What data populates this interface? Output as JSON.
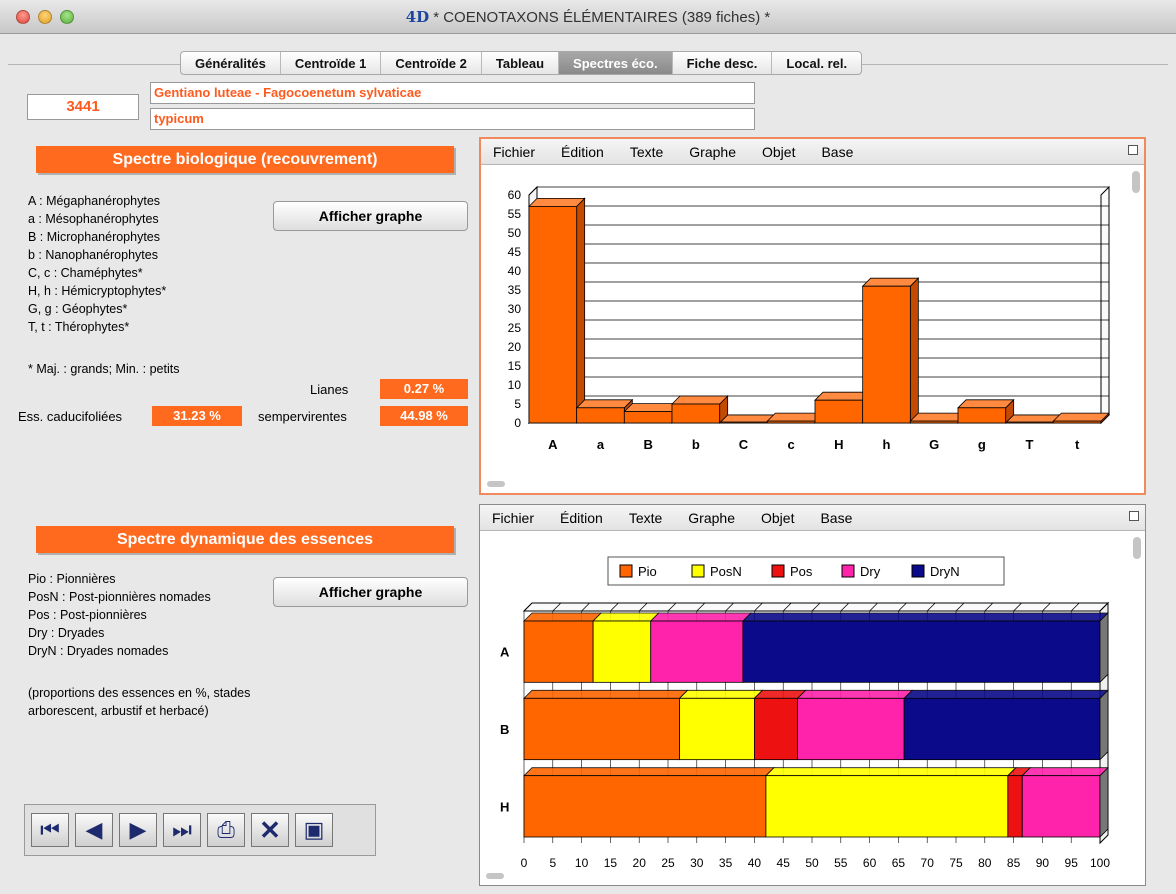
{
  "window": {
    "logo": "4D",
    "title": "* COENOTAXONS ÉLÉMENTAIRES (389 fiches) *"
  },
  "tabs": [
    {
      "label": "Généralités"
    },
    {
      "label": "Centroïde 1"
    },
    {
      "label": "Centroïde 2"
    },
    {
      "label": "Tableau"
    },
    {
      "label": "Spectres éco.",
      "active": true
    },
    {
      "label": "Fiche desc."
    },
    {
      "label": "Local. rel."
    }
  ],
  "record": {
    "number": "3441",
    "name_line1": "Gentiano luteae - Fagocoenetum sylvaticae",
    "name_line2": "typicum"
  },
  "bio": {
    "title": "Spectre biologique (recouvrement)",
    "legend": [
      "A : Mégaphanérophytes",
      "a : Mésophanérophytes",
      "B : Microphanérophytes",
      "b : Nanophanérophytes",
      "C, c : Chaméphytes*",
      "H, h : Hémicryptophytes*",
      "G, g : Géophytes*",
      "T, t : Thérophytes*"
    ],
    "note": "* Maj. : grands; Min. : petits",
    "button": "Afficher graphe",
    "lianes_label": "Lianes",
    "lianes_value": "0.27 %",
    "cad_label": "Ess. caducifoliées",
    "cad_value": "31.23 %",
    "semp_label": "sempervirentes",
    "semp_value": "44.98 %"
  },
  "dyn": {
    "title": "Spectre dynamique des essences",
    "legend": [
      "Pio : Pionnières",
      "PosN : Post-pionnières nomades",
      "Pos : Post-pionnières",
      "Dry : Dryades",
      "DryN : Dryades nomades"
    ],
    "note1": "(proportions des essences en %, stades",
    "note2": "arborescent, arbustif et herbacé)",
    "button": "Afficher graphe"
  },
  "graph_menu": [
    "Fichier",
    "Édition",
    "Texte",
    "Graphe",
    "Objet",
    "Base"
  ],
  "colors": {
    "accent": "#ff6a1f",
    "Pio": "#ff6600",
    "PosN": "#ffff00",
    "Pos": "#ee1111",
    "Dry": "#ff22aa",
    "DryN": "#0a0a8a"
  },
  "toolbar_icons": [
    "first-record-icon",
    "previous-record-icon",
    "next-record-icon",
    "last-record-icon",
    "print-icon",
    "delete-icon",
    "save-icon"
  ],
  "chart_data": [
    {
      "type": "bar",
      "categories": [
        "A",
        "a",
        "B",
        "b",
        "C",
        "c",
        "H",
        "h",
        "G",
        "g",
        "T",
        "t"
      ],
      "values": [
        57,
        4,
        3,
        5,
        0,
        0.5,
        6,
        36,
        0.5,
        4,
        0,
        0.5
      ],
      "ylim": [
        0,
        60
      ],
      "yticks": [
        0,
        5,
        10,
        15,
        20,
        25,
        30,
        35,
        40,
        45,
        50,
        55,
        60
      ],
      "grid": true
    },
    {
      "type": "bar",
      "orientation": "horizontal-stacked",
      "categories": [
        "A",
        "B",
        "H"
      ],
      "series": [
        {
          "name": "Pio",
          "values": [
            12,
            27,
            42
          ]
        },
        {
          "name": "PosN",
          "values": [
            10,
            13,
            42
          ]
        },
        {
          "name": "Pos",
          "values": [
            0,
            7.5,
            2.5
          ]
        },
        {
          "name": "Dry",
          "values": [
            16,
            18.5,
            13.5
          ]
        },
        {
          "name": "DryN",
          "values": [
            62,
            34,
            0
          ]
        }
      ],
      "xlim": [
        0,
        100
      ],
      "xticks": [
        0,
        5,
        10,
        15,
        20,
        25,
        30,
        35,
        40,
        45,
        50,
        55,
        60,
        65,
        70,
        75,
        80,
        85,
        90,
        95,
        100
      ],
      "legend": "top",
      "grid": true
    }
  ]
}
